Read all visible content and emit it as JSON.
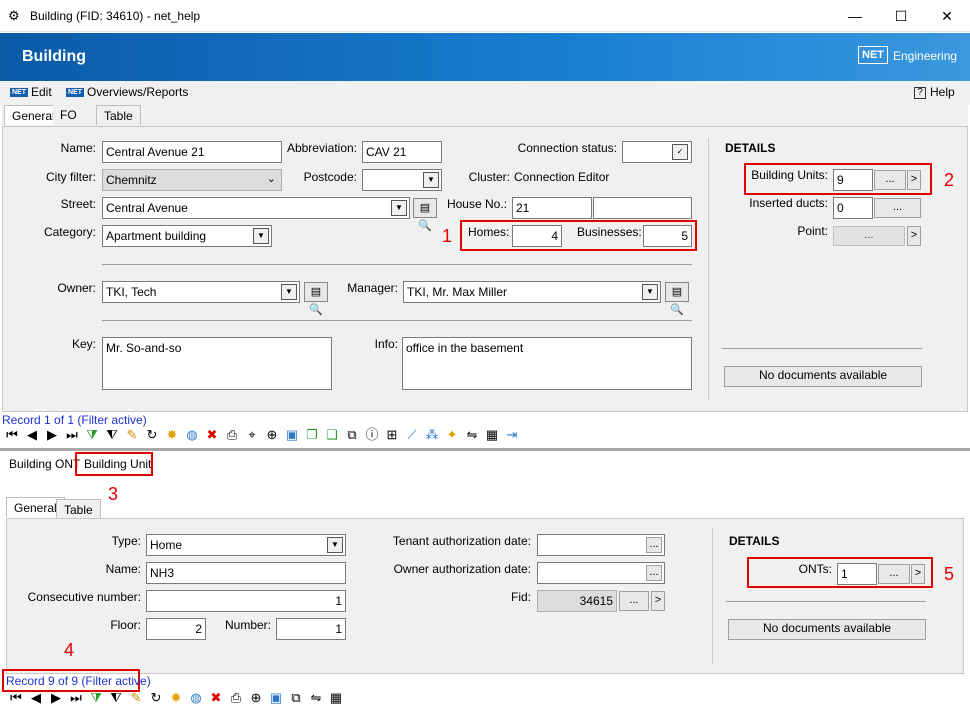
{
  "window": {
    "title": "Building (FID: 34610) - net_help",
    "minimize": "—",
    "maximize": "☐",
    "close": "✕"
  },
  "banner": {
    "title": "Building",
    "logo_box": "NET",
    "logo_text": "Engineering"
  },
  "menu": {
    "edit": "Edit",
    "overviews": "Overviews/Reports",
    "help": "Help",
    "net_icon": "NET"
  },
  "top_tabs": [
    "General",
    "FO",
    "Table"
  ],
  "building": {
    "name_label": "Name:",
    "name": "Central Avenue 21",
    "abbr_label": "Abbreviation:",
    "abbr": "CAV 21",
    "conn_label": "Connection status:",
    "conn_check": "✓",
    "city_label": "City filter:",
    "city": "Chemnitz",
    "postcode_label": "Postcode:",
    "postcode": "",
    "cluster_label": "Cluster:",
    "cluster": "Connection Editor",
    "street_label": "Street:",
    "street": "Central Avenue",
    "house_label": "House No.:",
    "house": "21",
    "house_suffix": "",
    "category_label": "Category:",
    "category": "Apartment building",
    "homes_label": "Homes:",
    "homes": "4",
    "businesses_label": "Businesses:",
    "businesses": "5",
    "owner_label": "Owner:",
    "owner": "TKI, Tech",
    "manager_label": "Manager:",
    "manager": "TKI, Mr. Max Miller",
    "key_label": "Key:",
    "key": "Mr. So-and-so",
    "info_label": "Info:",
    "info": "office in the basement"
  },
  "details_top": {
    "heading": "DETAILS",
    "bu_label": "Building Units:",
    "bu_value": "9",
    "bu_btn": "...",
    "bu_nav": ">",
    "ducts_label": "Inserted ducts:",
    "ducts_value": "0",
    "ducts_btn": "...",
    "point_label": "Point:",
    "point_btn": "...",
    "point_nav": ">",
    "nodocs": "No documents available"
  },
  "record_top": "Record 1 of 1 (Filter active)",
  "bottom_tabs": [
    "Building ONT",
    "Building Unit"
  ],
  "sub_tabs": [
    "General",
    "Table"
  ],
  "unit": {
    "type_label": "Type:",
    "type": "Home",
    "name_label": "Name:",
    "name": "NH3",
    "consec_label": "Consecutive number:",
    "consec": "1",
    "floor_label": "Floor:",
    "floor": "2",
    "number_label": "Number:",
    "number": "1",
    "tenant_label": "Tenant authorization date:",
    "tenant": "",
    "owner_label": "Owner authorization date:",
    "owner": "",
    "fid_label": "Fid:",
    "fid": "34615",
    "small_btn": "...",
    "nav": ">"
  },
  "details_bottom": {
    "heading": "DETAILS",
    "onts_label": "ONTs:",
    "onts_value": "1",
    "onts_btn": "...",
    "onts_nav": ">",
    "nodocs": "No documents available"
  },
  "record_bottom": "Record 9 of 9 (Filter active)",
  "annotations": [
    "1",
    "2",
    "3",
    "4",
    "5"
  ],
  "colors": {
    "banner": "#1b7fd1",
    "annotation": "#e00000",
    "record_text": "#1d33d1"
  }
}
